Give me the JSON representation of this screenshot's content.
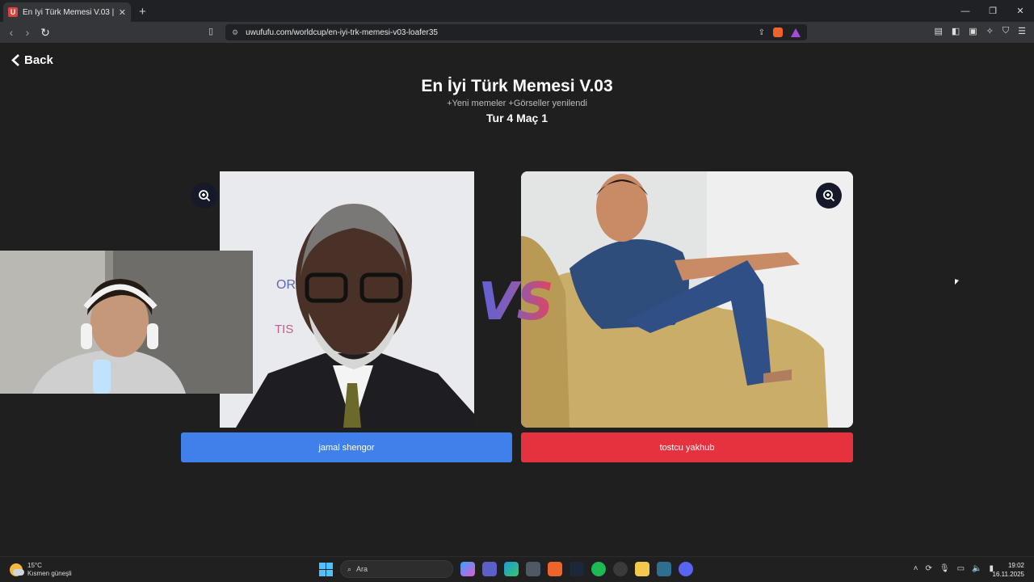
{
  "browser": {
    "tab_title": "En İyi Türk Memesi V.03 | UwUFufu",
    "favicon_letter": "U",
    "tab_close": "✕",
    "new_tab": "+",
    "window_controls": [
      "—",
      "❐",
      "✕"
    ],
    "url": "uwufufu.com/worldcup/en-iyi-trk-memesi-v03-loafer35"
  },
  "page": {
    "back_label": "Back",
    "title": "En İyi Türk Memesi V.03",
    "subtitle": "+Yeni memeler +Görseller yenilendi",
    "round_label": "Tur 4 Maç 1",
    "vs_text": "VS",
    "left_choice": {
      "label": "jamal shengor",
      "color": "#3f80ea"
    },
    "right_choice": {
      "label": "tostcu yakhub",
      "color": "#e5323e"
    },
    "accent_gradient": [
      "#5b63d9",
      "#e2455e"
    ]
  },
  "taskbar": {
    "weather_temp": "15°C",
    "weather_desc": "Kısmen güneşli",
    "search_placeholder": "Ara",
    "time": "19:02",
    "date": "16.11.2025"
  }
}
